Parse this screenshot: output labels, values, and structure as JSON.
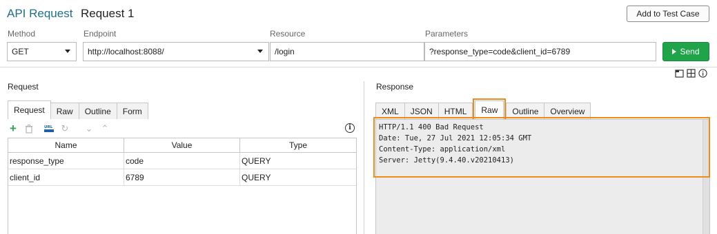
{
  "header": {
    "title_prefix": "API Request",
    "title_name": "Request 1",
    "add_button": "Add to Test Case"
  },
  "fields": {
    "method_label": "Method",
    "method_value": "GET",
    "endpoint_label": "Endpoint",
    "endpoint_value": "http://localhost:8088/",
    "resource_label": "Resource",
    "resource_value": "/login",
    "parameters_label": "Parameters",
    "parameters_value": "?response_type=code&client_id=6789",
    "send_button": "Send"
  },
  "request": {
    "label": "Request",
    "tabs": [
      "Request",
      "Raw",
      "Outline",
      "Form"
    ],
    "active_tab": "Request",
    "columns": [
      "Name",
      "Value",
      "Type"
    ],
    "rows": [
      {
        "name": "response_type",
        "value": "code",
        "type": "QUERY"
      },
      {
        "name": "client_id",
        "value": "6789",
        "type": "QUERY"
      }
    ]
  },
  "response": {
    "label": "Response",
    "tabs": [
      "XML",
      "JSON",
      "HTML",
      "Raw",
      "Overview"
    ],
    "tab_outline": "Outline",
    "active_tab": "Raw",
    "lines": [
      "HTTP/1.1 400 Bad Request",
      "Date: Tue, 27 Jul 2021 12:05:34 GMT",
      "Content-Type: application/xml",
      "Server: Jetty(9.4.40.v20210413)"
    ]
  },
  "icons": [
    "add-icon",
    "delete-icon",
    "url-encode-icon",
    "refresh-icon",
    "move-down-icon",
    "move-up-icon",
    "info-icon",
    "layout-icon",
    "grid-icon"
  ],
  "colors": {
    "title_accent": "#1f6f8b",
    "send": "#1fa44a",
    "highlight": "#f08a1a"
  }
}
